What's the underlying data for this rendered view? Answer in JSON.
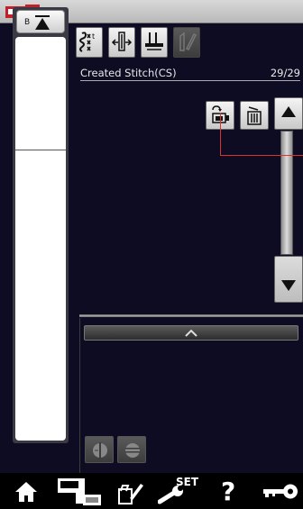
{
  "header": {
    "title": "Created Stitch(CS)",
    "page_count": "29/29"
  },
  "left_panel": {
    "top_button_letter": "B"
  },
  "icons": {
    "top_row": [
      "stitch-pattern-icon",
      "needle-position-icon",
      "presser-foot-icon",
      "edit-stitch-icon"
    ],
    "right": [
      "save-icon",
      "delete-icon"
    ],
    "scroll": [
      "scroll-up-icon",
      "scroll-down-icon"
    ]
  },
  "bottombar": {
    "set_label": "SET",
    "help_label": "?"
  },
  "colors": {
    "background": "#0d0c22",
    "accent_line": "#e0312f"
  }
}
